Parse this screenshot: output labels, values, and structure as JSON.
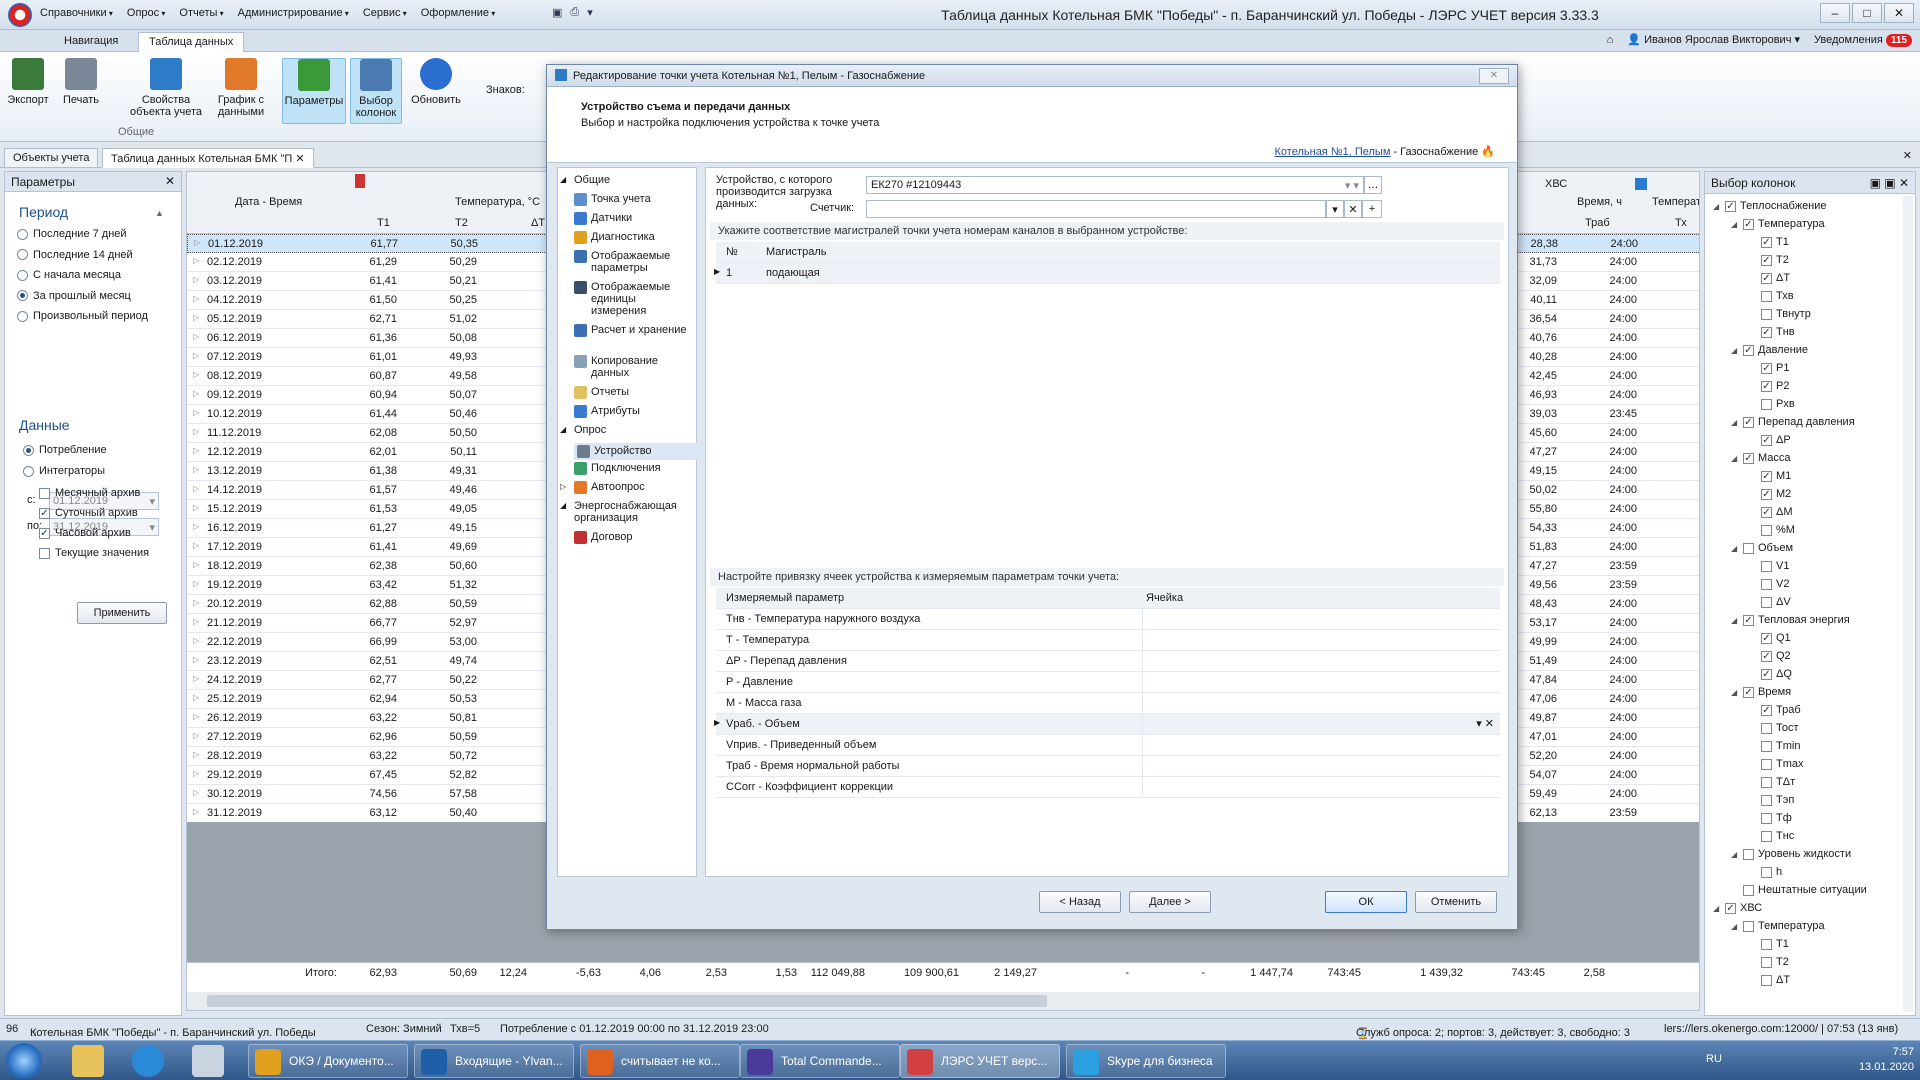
{
  "app": {
    "title": "Таблица данных Котельная БМК \"Победы\" - п. Баранчинский ул. Победы - ЛЭРС УЧЕТ версия 3.33.3",
    "menu": [
      "Справочники",
      "Опрос",
      "Отчеты",
      "Администрирование",
      "Сервис",
      "Оформление"
    ],
    "window_buttons": [
      "–",
      "□",
      "✕"
    ]
  },
  "ribbon_tabs": [
    "Навигация",
    "Таблица данных"
  ],
  "user": {
    "name": "Иванов Ярослав Викторович",
    "notifications_label": "Уведомления",
    "notifications_count": "115"
  },
  "ribbon": {
    "buttons": [
      "Экспорт",
      "Печать",
      "Свойства объекта учета",
      "График с данными",
      "Параметры",
      "Выбор колонок",
      "Обновить"
    ],
    "group_label": "Общие",
    "znakov_label": "Знаков:"
  },
  "doc_tabs": [
    "Объекты учета",
    "Таблица данных Котельная БМК \"П"
  ],
  "params": {
    "title": "Параметры",
    "period_header": "Период",
    "period_options": [
      "Последние 7 дней",
      "Последние 14 дней",
      "С начала месяца",
      "За прошлый месяц",
      "Произвольный период"
    ],
    "period_selected": 3,
    "from_label": "с:",
    "from_value": "01.12.2019",
    "to_label": "по:",
    "to_value": "31.12.2019",
    "data_header": "Данные",
    "data_options": [
      "Потребление",
      "Интеграторы"
    ],
    "archives": [
      {
        "label": "Месячный архив",
        "checked": false
      },
      {
        "label": "Суточный архив",
        "checked": true
      },
      {
        "label": "Часовой архив",
        "checked": true
      },
      {
        "label": "Текущие значения",
        "checked": false
      }
    ],
    "apply_label": "Применить"
  },
  "grid": {
    "col_datetime": "Дата - Время",
    "col_temp": "Температура, °С",
    "col_t1": "Т1",
    "col_t2": "Т2",
    "col_dt": "ΔТ",
    "col_hvs": "ХВС",
    "col_time": "Время, ч",
    "col_temp2": "Температ",
    "col_traab": "Траб",
    "col_tx": "Тх",
    "rows": [
      {
        "d": "01.12.2019",
        "t1": "61,77",
        "t2": "50,35",
        "r": "28,38",
        "tr": "24:00"
      },
      {
        "d": "02.12.2019",
        "t1": "61,29",
        "t2": "50,29",
        "r": "31,73",
        "tr": "24:00"
      },
      {
        "d": "03.12.2019",
        "t1": "61,41",
        "t2": "50,21",
        "r": "32,09",
        "tr": "24:00"
      },
      {
        "d": "04.12.2019",
        "t1": "61,50",
        "t2": "50,25",
        "r": "40,11",
        "tr": "24:00"
      },
      {
        "d": "05.12.2019",
        "t1": "62,71",
        "t2": "51,02",
        "r": "36,54",
        "tr": "24:00"
      },
      {
        "d": "06.12.2019",
        "t1": "61,36",
        "t2": "50,08",
        "r": "40,76",
        "tr": "24:00"
      },
      {
        "d": "07.12.2019",
        "t1": "61,01",
        "t2": "49,93",
        "r": "40,28",
        "tr": "24:00"
      },
      {
        "d": "08.12.2019",
        "t1": "60,87",
        "t2": "49,58",
        "r": "42,45",
        "tr": "24:00"
      },
      {
        "d": "09.12.2019",
        "t1": "60,94",
        "t2": "50,07",
        "r": "46,93",
        "tr": "24:00"
      },
      {
        "d": "10.12.2019",
        "t1": "61,44",
        "t2": "50,46",
        "r": "39,03",
        "tr": "23:45"
      },
      {
        "d": "11.12.2019",
        "t1": "62,08",
        "t2": "50,50",
        "r": "45,60",
        "tr": "24:00"
      },
      {
        "d": "12.12.2019",
        "t1": "62,01",
        "t2": "50,11",
        "r": "47,27",
        "tr": "24:00"
      },
      {
        "d": "13.12.2019",
        "t1": "61,38",
        "t2": "49,31",
        "r": "49,15",
        "tr": "24:00"
      },
      {
        "d": "14.12.2019",
        "t1": "61,57",
        "t2": "49,46",
        "r": "50,02",
        "tr": "24:00"
      },
      {
        "d": "15.12.2019",
        "t1": "61,53",
        "t2": "49,05",
        "r": "55,80",
        "tr": "24:00"
      },
      {
        "d": "16.12.2019",
        "t1": "61,27",
        "t2": "49,15",
        "r": "54,33",
        "tr": "24:00"
      },
      {
        "d": "17.12.2019",
        "t1": "61,41",
        "t2": "49,69",
        "r": "51,83",
        "tr": "24:00"
      },
      {
        "d": "18.12.2019",
        "t1": "62,38",
        "t2": "50,60",
        "r": "47,27",
        "tr": "23:59"
      },
      {
        "d": "19.12.2019",
        "t1": "63,42",
        "t2": "51,32",
        "r": "49,56",
        "tr": "23:59"
      },
      {
        "d": "20.12.2019",
        "t1": "62,88",
        "t2": "50,59",
        "r": "48,43",
        "tr": "24:00"
      },
      {
        "d": "21.12.2019",
        "t1": "66,77",
        "t2": "52,97",
        "r": "53,17",
        "tr": "24:00"
      },
      {
        "d": "22.12.2019",
        "t1": "66,99",
        "t2": "53,00",
        "r": "49,99",
        "tr": "24:00"
      },
      {
        "d": "23.12.2019",
        "t1": "62,51",
        "t2": "49,74",
        "r": "51,49",
        "tr": "24:00"
      },
      {
        "d": "24.12.2019",
        "t1": "62,77",
        "t2": "50,22",
        "r": "47,84",
        "tr": "24:00"
      },
      {
        "d": "25.12.2019",
        "t1": "62,94",
        "t2": "50,53",
        "r": "47,06",
        "tr": "24:00"
      },
      {
        "d": "26.12.2019",
        "t1": "63,22",
        "t2": "50,81",
        "r": "49,87",
        "tr": "24:00"
      },
      {
        "d": "27.12.2019",
        "t1": "62,96",
        "t2": "50,59",
        "r": "47,01",
        "tr": "24:00"
      },
      {
        "d": "28.12.2019",
        "t1": "63,22",
        "t2": "50,72",
        "r": "52,20",
        "tr": "24:00"
      },
      {
        "d": "29.12.2019",
        "t1": "67,45",
        "t2": "52,82",
        "r": "54,07",
        "tr": "24:00"
      },
      {
        "d": "30.12.2019",
        "t1": "74,56",
        "t2": "57,58",
        "r": "59,49",
        "tr": "24:00"
      },
      {
        "d": "31.12.2019",
        "t1": "63,12",
        "t2": "50,40",
        "r": "62,13",
        "tr": "23:59"
      }
    ],
    "totals_label": "Итого:",
    "totals": [
      "62,93",
      "50,69",
      "12,24",
      "-5,63",
      "4,06",
      "2,53",
      "1,53",
      "112 049,88",
      "109 900,61",
      "2 149,27",
      "-",
      "-",
      "1 447,74",
      "743:45",
      "1 439,32",
      "743:45",
      "2,58"
    ]
  },
  "column_chooser": {
    "title": "Выбор колонок",
    "tree": [
      {
        "l": "Теплоснабжение",
        "lv": 0,
        "c": true,
        "e": true
      },
      {
        "l": "Температура",
        "lv": 1,
        "c": true,
        "e": true
      },
      {
        "l": "Т1",
        "lv": 2,
        "c": true
      },
      {
        "l": "Т2",
        "lv": 2,
        "c": true
      },
      {
        "l": "ΔТ",
        "lv": 2,
        "c": true
      },
      {
        "l": "Тхв",
        "lv": 2,
        "c": false
      },
      {
        "l": "Твнутр",
        "lv": 2,
        "c": false
      },
      {
        "l": "Тнв",
        "lv": 2,
        "c": true
      },
      {
        "l": "Давление",
        "lv": 1,
        "c": true,
        "e": true
      },
      {
        "l": "P1",
        "lv": 2,
        "c": true
      },
      {
        "l": "P2",
        "lv": 2,
        "c": true
      },
      {
        "l": "Pхв",
        "lv": 2,
        "c": false
      },
      {
        "l": "Перепад давления",
        "lv": 1,
        "c": true,
        "e": true
      },
      {
        "l": "ΔP",
        "lv": 2,
        "c": true
      },
      {
        "l": "Масса",
        "lv": 1,
        "c": true,
        "e": true
      },
      {
        "l": "M1",
        "lv": 2,
        "c": true
      },
      {
        "l": "M2",
        "lv": 2,
        "c": true
      },
      {
        "l": "ΔM",
        "lv": 2,
        "c": true
      },
      {
        "l": "%M",
        "lv": 2,
        "c": false
      },
      {
        "l": "Объем",
        "lv": 1,
        "c": false,
        "e": true
      },
      {
        "l": "V1",
        "lv": 2,
        "c": false
      },
      {
        "l": "V2",
        "lv": 2,
        "c": false
      },
      {
        "l": "ΔV",
        "lv": 2,
        "c": false
      },
      {
        "l": "Тепловая энергия",
        "lv": 1,
        "c": true,
        "e": true
      },
      {
        "l": "Q1",
        "lv": 2,
        "c": true
      },
      {
        "l": "Q2",
        "lv": 2,
        "c": true
      },
      {
        "l": "ΔQ",
        "lv": 2,
        "c": true
      },
      {
        "l": "Время",
        "lv": 1,
        "c": true,
        "e": true
      },
      {
        "l": "Траб",
        "lv": 2,
        "c": true
      },
      {
        "l": "Тост",
        "lv": 2,
        "c": false
      },
      {
        "l": "Tmin",
        "lv": 2,
        "c": false
      },
      {
        "l": "Tmax",
        "lv": 2,
        "c": false
      },
      {
        "l": "TΔт",
        "lv": 2,
        "c": false
      },
      {
        "l": "Tэп",
        "lv": 2,
        "c": false
      },
      {
        "l": "Тф",
        "lv": 2,
        "c": false
      },
      {
        "l": "Тнс",
        "lv": 2,
        "c": false
      },
      {
        "l": "Уровень жидкости",
        "lv": 1,
        "c": false,
        "e": true
      },
      {
        "l": "h",
        "lv": 2,
        "c": false
      },
      {
        "l": "Нештатные ситуации",
        "lv": 1,
        "c": false
      },
      {
        "l": "ХВС",
        "lv": 0,
        "c": true,
        "e": true
      },
      {
        "l": "Температура",
        "lv": 1,
        "c": false,
        "e": true
      },
      {
        "l": "Т1",
        "lv": 2,
        "c": false
      },
      {
        "l": "Т2",
        "lv": 2,
        "c": false
      },
      {
        "l": "ΔТ",
        "lv": 2,
        "c": false
      }
    ]
  },
  "modal": {
    "title": "Редактирование точки учета Котельная №1, Пелым - Газоснабжение",
    "header_title": "Устройство съема и передачи данных",
    "header_subtitle": "Выбор и настройка подключения устройства к точке учета",
    "link_text": "Котельная №1, Пелым",
    "link_suffix": " - Газоснабжение",
    "nav": [
      {
        "l": "Общие",
        "grp": true
      },
      {
        "l": "Точка учета"
      },
      {
        "l": "Датчики"
      },
      {
        "l": "Диагностика"
      },
      {
        "l": "Отображаемые параметры"
      },
      {
        "l": "Отображаемые единицы измерения"
      },
      {
        "l": "Расчет и хранение"
      },
      {
        "l": "Копирование данных"
      },
      {
        "l": "Отчеты"
      },
      {
        "l": "Атрибуты"
      },
      {
        "l": "Опрос",
        "grp": true
      },
      {
        "l": "Устройство",
        "act": true
      },
      {
        "l": "Подключения"
      },
      {
        "l": "Автоопрос",
        "exp": true
      },
      {
        "l": "Энергоснабжающая организация",
        "grp": true
      },
      {
        "l": "Договор"
      }
    ],
    "device_label": "Устройство, с которого производится загрузка данных:",
    "device_value": "ЕК270 #12109443",
    "meter_label": "Счетчик:",
    "meter_value": "",
    "hint1": "Укажите соответствие магистралей точки учета номерам каналов в выбранном устройстве:",
    "mag_cols": [
      "№",
      "Магистраль"
    ],
    "mag_rows": [
      {
        "n": "1",
        "m": "подающая"
      }
    ],
    "hint2": "Настройте привязку ячеек устройства к измеряемым параметрам точки учета:",
    "param_cols": [
      "Измеряемый параметр",
      "Ячейка"
    ],
    "param_rows": [
      "Тнв - Температура наружного воздуха",
      "Т - Температура",
      "ΔP - Перепад давления",
      "P - Давление",
      "M - Масса газа",
      "Vраб. - Объем",
      "Vприв. - Приведенный объем",
      "Траб - Время нормальной работы",
      "CCorr - Коэффициент коррекции"
    ],
    "buttons": {
      "back": "< Назад",
      "next": "Далее >",
      "ok": "ОК",
      "cancel": "Отменить"
    }
  },
  "status": {
    "count": "96",
    "object": "Котельная БМК \"Победы\" - п. Баранчинский ул. Победы",
    "season": "Сезон: Зимний",
    "txv": "Тхв=5",
    "consumption": "Потребление с 01.12.2019 00:00 по 31.12.2019 23:00",
    "services": "Служб опроса: 2; портов: 3, действует: 3, свободно: 3",
    "server": "lers://lers.okenergo.com:12000/ | 07:53 (13 янв)"
  },
  "taskbar": {
    "items": [
      "ОКЭ / Документо...",
      "Входящие - Ylvan...",
      "считывает не ко...",
      "Total Commande...",
      "ЛЭРС УЧЕТ верс...",
      "Skype для бизнеса"
    ],
    "lang": "RU",
    "time": "7:57",
    "date": "13.01.2020"
  },
  "colors": {
    "accent": "#1f4f9c",
    "selection": "#cfe6f8",
    "badge": "#e02020"
  }
}
